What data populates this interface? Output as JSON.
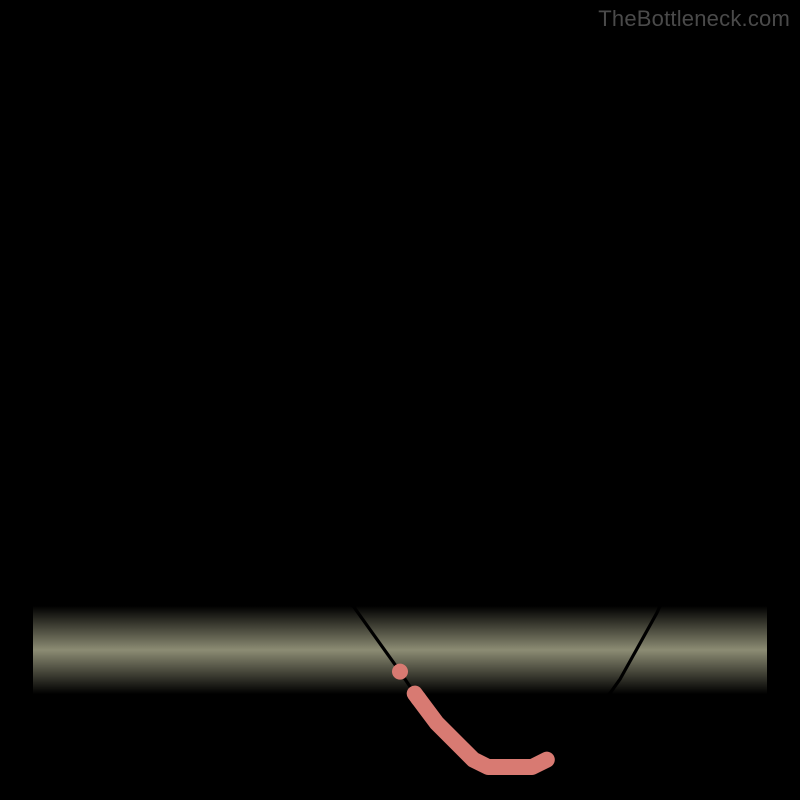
{
  "watermark": {
    "text": "TheBottleneck.com"
  },
  "colors": {
    "background": "#000000",
    "curve": "#000000",
    "highlight": "#d87a72",
    "gradient_stops": [
      "#ff1a4b",
      "#ff8a33",
      "#ffd51a",
      "#ffff55",
      "#ffffa8",
      "#9dff90",
      "#20d98a"
    ]
  },
  "chart_data": {
    "type": "line",
    "title": "",
    "xlabel": "",
    "ylabel": "",
    "xlim": [
      0,
      100
    ],
    "ylim": [
      0,
      100
    ],
    "x": [
      0,
      5,
      10,
      15,
      20,
      25,
      30,
      35,
      40,
      45,
      50,
      52,
      55,
      58,
      60,
      62,
      64,
      66,
      68,
      70,
      75,
      80,
      85,
      90,
      95,
      100
    ],
    "values": [
      100,
      90,
      80,
      70,
      61,
      52,
      43,
      35,
      27,
      20,
      13,
      10,
      6,
      3,
      1,
      0,
      0,
      0,
      0,
      1,
      5,
      12,
      21,
      32,
      44,
      55
    ],
    "highlight_range_x": [
      52,
      70
    ],
    "annotations": []
  }
}
